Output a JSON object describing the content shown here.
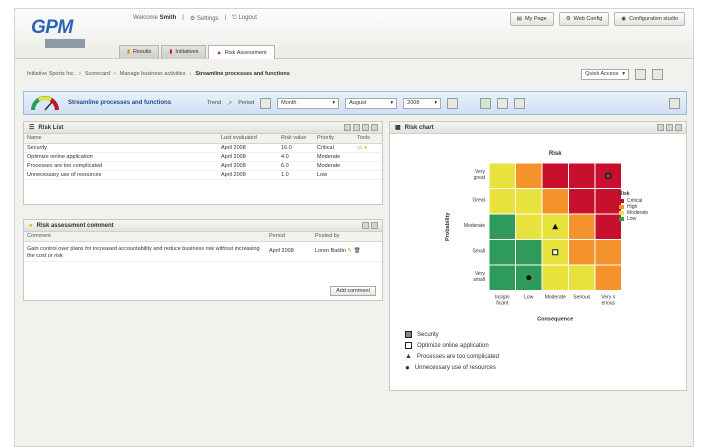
{
  "app": {
    "logo": "GPM",
    "logo_sub": "",
    "welcome_prefix": "Welcome",
    "user": "Smith",
    "settings": "Settings",
    "logout": "Logout"
  },
  "top_buttons": [
    "My Page",
    "Web Config",
    "Configuration studio"
  ],
  "tabs": [
    "Results",
    "Initiatives",
    "Risk Assessment"
  ],
  "breadcrumb": {
    "items": [
      "Initiative Sports Inc.",
      "Scorecard",
      "Manage business activities"
    ],
    "current": "Streamline processes and functions"
  },
  "quick_access": "Quick Access",
  "toolbar": {
    "title": "Streamline processes and functions",
    "trend_label": "Trend",
    "period_label": "Period",
    "period_type": "Month",
    "month": "August",
    "year": "2008"
  },
  "risk_list": {
    "title": "Risk List",
    "columns": [
      "Name",
      "Last evaluated",
      "Risk value",
      "Priority",
      "Tools"
    ],
    "rows": [
      {
        "name": "Security",
        "date": "April 2008",
        "value": "16.0",
        "priority": "Critical"
      },
      {
        "name": "Optimize online application",
        "date": "April 2008",
        "value": "4.0",
        "priority": "Moderate"
      },
      {
        "name": "Processes are too complicated",
        "date": "April 2008",
        "value": "6.0",
        "priority": "Moderate"
      },
      {
        "name": "Unnecessary use of resources",
        "date": "April 2008",
        "value": "1.0",
        "priority": "Low"
      }
    ]
  },
  "comment_panel": {
    "title": "Risk assessment comment",
    "columns": [
      "Comment",
      "Period",
      "Posted by"
    ],
    "rows": [
      {
        "comment": "Gain control over plans for increased accountability and reduce business risk without increasing the cost or risk",
        "period": "April 2008",
        "posted_by": "Loren Baldin"
      }
    ],
    "add_button": "Add comment"
  },
  "risk_chart": {
    "title": "Risk chart",
    "chart_title": "Risk",
    "y_axis": "Probability",
    "x_axis": "Consequence",
    "y_ticks": [
      "Very small",
      "Small",
      "Moderate",
      "Great",
      "Very great"
    ],
    "x_ticks": [
      "Insignificant",
      "Low",
      "Moderate",
      "Serious",
      "Very serious"
    ],
    "legend_title": "Risk",
    "legend": [
      {
        "label": "Critical",
        "color": "#c8102e"
      },
      {
        "label": "High",
        "color": "#f4922b"
      },
      {
        "label": "Moderate",
        "color": "#e8e23c"
      },
      {
        "label": "Low",
        "color": "#2e9b5a"
      }
    ],
    "cell_colors": [
      [
        "green",
        "green",
        "yellow",
        "yellow",
        "orange"
      ],
      [
        "green",
        "green",
        "yellow",
        "orange",
        "orange"
      ],
      [
        "green",
        "yellow",
        "yellow",
        "orange",
        "red"
      ],
      [
        "yellow",
        "yellow",
        "orange",
        "red",
        "red"
      ],
      [
        "yellow",
        "orange",
        "red",
        "red",
        "red"
      ]
    ],
    "markers": [
      {
        "label": "Security",
        "row": 4,
        "col": 4,
        "shape": "square"
      },
      {
        "label": "Optimize online application",
        "row": 1,
        "col": 2,
        "shape": "square-hollow"
      },
      {
        "label": "Processes are too complicated",
        "row": 2,
        "col": 2,
        "shape": "triangle"
      },
      {
        "label": "Unnecessary use of resources",
        "row": 0,
        "col": 1,
        "shape": "dot"
      }
    ]
  },
  "chart_data": {
    "type": "heatmap",
    "title": "Risk",
    "xlabel": "Consequence",
    "ylabel": "Probability",
    "x": [
      "Insignificant",
      "Low",
      "Moderate",
      "Serious",
      "Very serious"
    ],
    "y": [
      "Very small",
      "Small",
      "Moderate",
      "Great",
      "Very great"
    ],
    "series": [
      {
        "name": "Security",
        "value": "16.0"
      },
      {
        "name": "Optimize online application",
        "value": "4.0"
      },
      {
        "name": "Processes are too complicated",
        "value": "6.0"
      },
      {
        "name": "Unnecessary use of resources",
        "value": "1.0"
      }
    ]
  }
}
